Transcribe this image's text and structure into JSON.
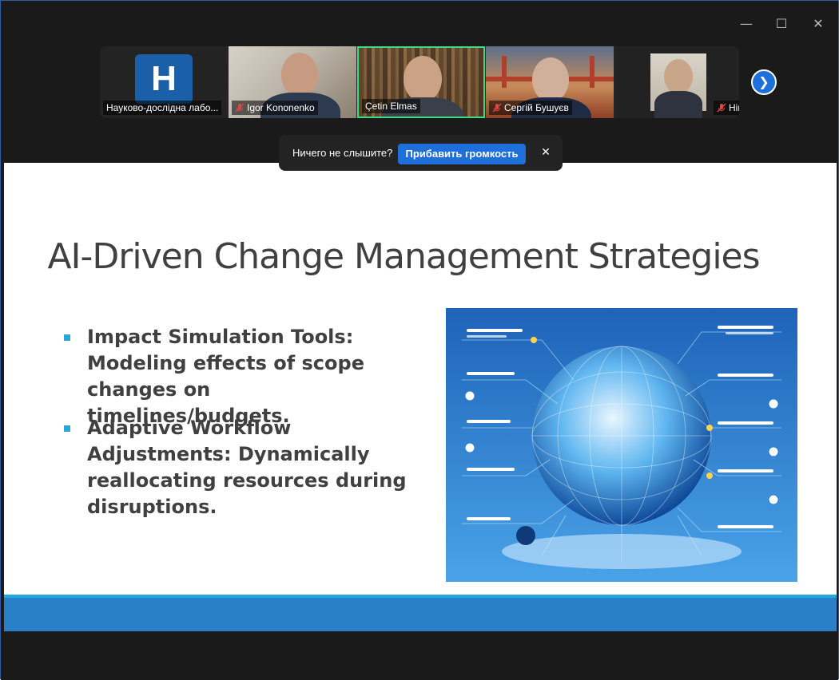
{
  "window": {
    "controls": {
      "minimize": "—",
      "maximize": "☐",
      "close": "✕"
    }
  },
  "participants": [
    {
      "name": "Науково-дослідна лабо...",
      "avatar_letter": "H",
      "muted": false
    },
    {
      "name": "Igor Kononenko",
      "muted": true
    },
    {
      "name": "Çetin Elmas",
      "muted": false,
      "active_speaker": true
    },
    {
      "name": "Сергій Бушуєв",
      "muted": true
    },
    {
      "name": "Hiroshi TANAKA",
      "muted": true
    }
  ],
  "next_page_icon": "chevron-right-icon",
  "audio_notice": {
    "text": "Ничего не слышите?",
    "button": "Прибавить громкость",
    "close": "✕"
  },
  "slide": {
    "title": "AI-Driven Change Management Strategies",
    "bullets": [
      "Impact Simulation Tools: Modeling effects of scope changes on timelines/budgets.",
      "Adaptive Workflow Adjustments: Dynamically reallocating resources during disruptions."
    ]
  },
  "colors": {
    "accent_blue": "#1e6fd9",
    "speaker_border": "#3ddc84",
    "slide_footer": "#2a80c8",
    "bullet_marker": "#2ea5d8"
  }
}
